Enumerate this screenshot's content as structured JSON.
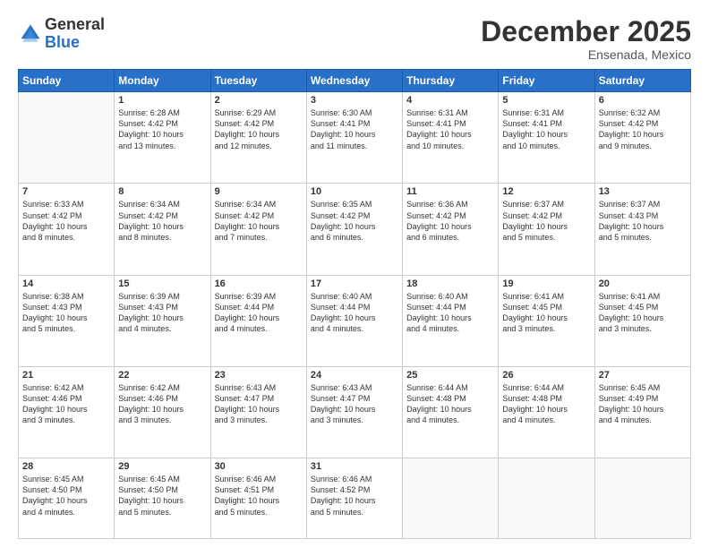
{
  "logo": {
    "general": "General",
    "blue": "Blue"
  },
  "title": "December 2025",
  "location": "Ensenada, Mexico",
  "days_header": [
    "Sunday",
    "Monday",
    "Tuesday",
    "Wednesday",
    "Thursday",
    "Friday",
    "Saturday"
  ],
  "weeks": [
    [
      {
        "num": "",
        "info": ""
      },
      {
        "num": "1",
        "info": "Sunrise: 6:28 AM\nSunset: 4:42 PM\nDaylight: 10 hours\nand 13 minutes."
      },
      {
        "num": "2",
        "info": "Sunrise: 6:29 AM\nSunset: 4:42 PM\nDaylight: 10 hours\nand 12 minutes."
      },
      {
        "num": "3",
        "info": "Sunrise: 6:30 AM\nSunset: 4:41 PM\nDaylight: 10 hours\nand 11 minutes."
      },
      {
        "num": "4",
        "info": "Sunrise: 6:31 AM\nSunset: 4:41 PM\nDaylight: 10 hours\nand 10 minutes."
      },
      {
        "num": "5",
        "info": "Sunrise: 6:31 AM\nSunset: 4:41 PM\nDaylight: 10 hours\nand 10 minutes."
      },
      {
        "num": "6",
        "info": "Sunrise: 6:32 AM\nSunset: 4:42 PM\nDaylight: 10 hours\nand 9 minutes."
      }
    ],
    [
      {
        "num": "7",
        "info": "Sunrise: 6:33 AM\nSunset: 4:42 PM\nDaylight: 10 hours\nand 8 minutes."
      },
      {
        "num": "8",
        "info": "Sunrise: 6:34 AM\nSunset: 4:42 PM\nDaylight: 10 hours\nand 8 minutes."
      },
      {
        "num": "9",
        "info": "Sunrise: 6:34 AM\nSunset: 4:42 PM\nDaylight: 10 hours\nand 7 minutes."
      },
      {
        "num": "10",
        "info": "Sunrise: 6:35 AM\nSunset: 4:42 PM\nDaylight: 10 hours\nand 6 minutes."
      },
      {
        "num": "11",
        "info": "Sunrise: 6:36 AM\nSunset: 4:42 PM\nDaylight: 10 hours\nand 6 minutes."
      },
      {
        "num": "12",
        "info": "Sunrise: 6:37 AM\nSunset: 4:42 PM\nDaylight: 10 hours\nand 5 minutes."
      },
      {
        "num": "13",
        "info": "Sunrise: 6:37 AM\nSunset: 4:43 PM\nDaylight: 10 hours\nand 5 minutes."
      }
    ],
    [
      {
        "num": "14",
        "info": "Sunrise: 6:38 AM\nSunset: 4:43 PM\nDaylight: 10 hours\nand 5 minutes."
      },
      {
        "num": "15",
        "info": "Sunrise: 6:39 AM\nSunset: 4:43 PM\nDaylight: 10 hours\nand 4 minutes."
      },
      {
        "num": "16",
        "info": "Sunrise: 6:39 AM\nSunset: 4:44 PM\nDaylight: 10 hours\nand 4 minutes."
      },
      {
        "num": "17",
        "info": "Sunrise: 6:40 AM\nSunset: 4:44 PM\nDaylight: 10 hours\nand 4 minutes."
      },
      {
        "num": "18",
        "info": "Sunrise: 6:40 AM\nSunset: 4:44 PM\nDaylight: 10 hours\nand 4 minutes."
      },
      {
        "num": "19",
        "info": "Sunrise: 6:41 AM\nSunset: 4:45 PM\nDaylight: 10 hours\nand 3 minutes."
      },
      {
        "num": "20",
        "info": "Sunrise: 6:41 AM\nSunset: 4:45 PM\nDaylight: 10 hours\nand 3 minutes."
      }
    ],
    [
      {
        "num": "21",
        "info": "Sunrise: 6:42 AM\nSunset: 4:46 PM\nDaylight: 10 hours\nand 3 minutes."
      },
      {
        "num": "22",
        "info": "Sunrise: 6:42 AM\nSunset: 4:46 PM\nDaylight: 10 hours\nand 3 minutes."
      },
      {
        "num": "23",
        "info": "Sunrise: 6:43 AM\nSunset: 4:47 PM\nDaylight: 10 hours\nand 3 minutes."
      },
      {
        "num": "24",
        "info": "Sunrise: 6:43 AM\nSunset: 4:47 PM\nDaylight: 10 hours\nand 3 minutes."
      },
      {
        "num": "25",
        "info": "Sunrise: 6:44 AM\nSunset: 4:48 PM\nDaylight: 10 hours\nand 4 minutes."
      },
      {
        "num": "26",
        "info": "Sunrise: 6:44 AM\nSunset: 4:48 PM\nDaylight: 10 hours\nand 4 minutes."
      },
      {
        "num": "27",
        "info": "Sunrise: 6:45 AM\nSunset: 4:49 PM\nDaylight: 10 hours\nand 4 minutes."
      }
    ],
    [
      {
        "num": "28",
        "info": "Sunrise: 6:45 AM\nSunset: 4:50 PM\nDaylight: 10 hours\nand 4 minutes."
      },
      {
        "num": "29",
        "info": "Sunrise: 6:45 AM\nSunset: 4:50 PM\nDaylight: 10 hours\nand 5 minutes."
      },
      {
        "num": "30",
        "info": "Sunrise: 6:46 AM\nSunset: 4:51 PM\nDaylight: 10 hours\nand 5 minutes."
      },
      {
        "num": "31",
        "info": "Sunrise: 6:46 AM\nSunset: 4:52 PM\nDaylight: 10 hours\nand 5 minutes."
      },
      {
        "num": "",
        "info": ""
      },
      {
        "num": "",
        "info": ""
      },
      {
        "num": "",
        "info": ""
      }
    ]
  ]
}
